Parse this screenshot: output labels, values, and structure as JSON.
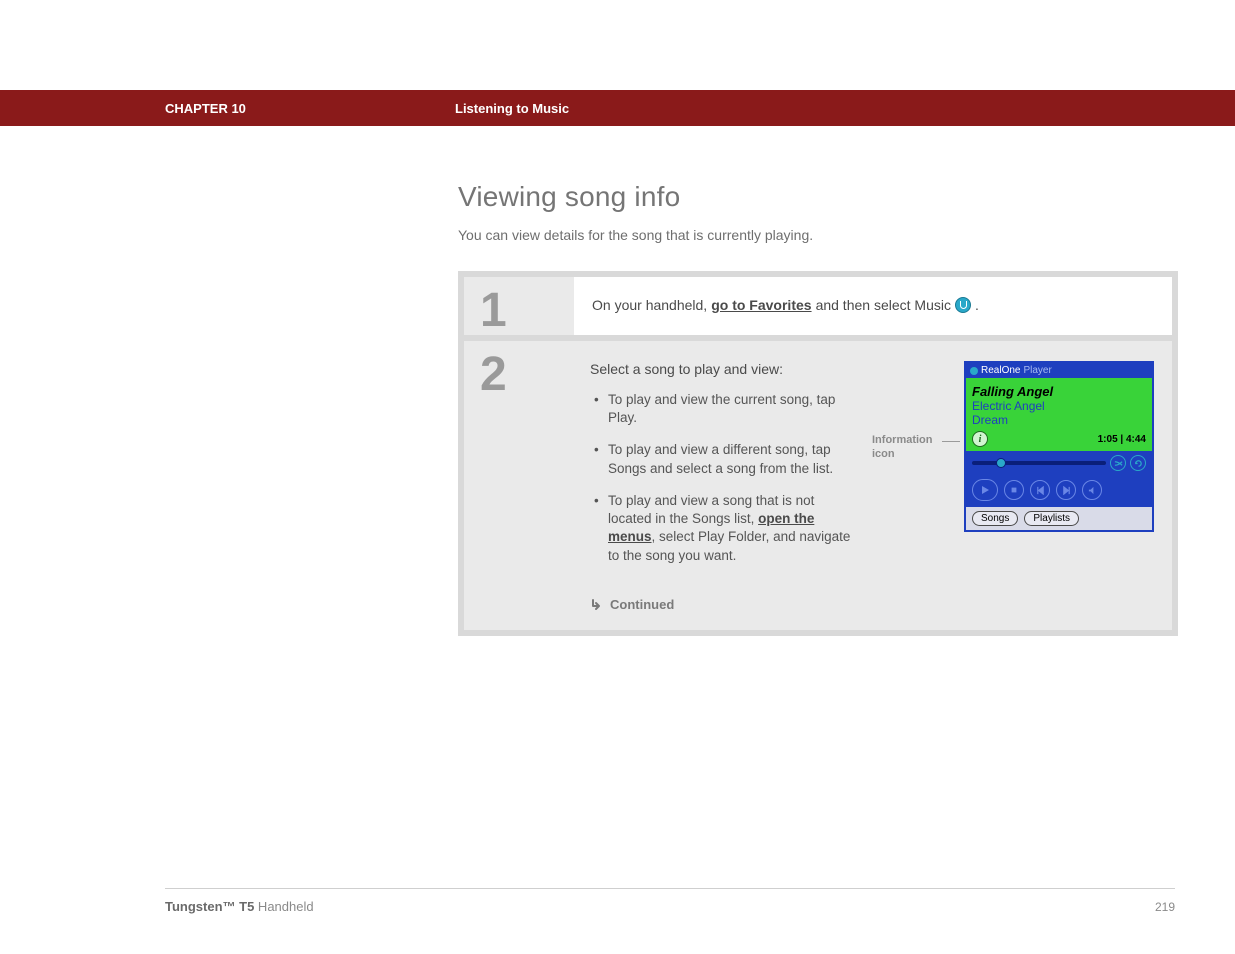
{
  "header": {
    "chapter_label": "CHAPTER 10",
    "section_title": "Listening to Music"
  },
  "title": "Viewing song info",
  "intro": "You can view details for the song that is currently playing.",
  "steps": {
    "s1": {
      "num": "1",
      "pre": "On your handheld, ",
      "link": "go to Favorites",
      "post": " and then select Music ",
      "dot": "."
    },
    "s2": {
      "num": "2",
      "lead": "Select a song to play and view:",
      "b1": "To play and view the current song, tap Play.",
      "b2": "To play and view a different song, tap Songs and select a song from the list.",
      "b3a": "To play and view a song that is not located in the Songs list, ",
      "b3link": "open the menus",
      "b3b": ", select Play Folder, and navigate to the song you want."
    }
  },
  "callout": {
    "line1": "Information",
    "line2": "icon"
  },
  "player": {
    "app1": "RealOne",
    "app2": "Player",
    "song": "Falling Angel",
    "artist": "Electric Angel",
    "album": "Dream",
    "time": "1:05 | 4:44",
    "tab_songs": "Songs",
    "tab_playlists": "Playlists"
  },
  "continued": "Continued",
  "footer": {
    "product_bold": "Tungsten™ T5",
    "product_rest": " Handheld",
    "page": "219"
  }
}
